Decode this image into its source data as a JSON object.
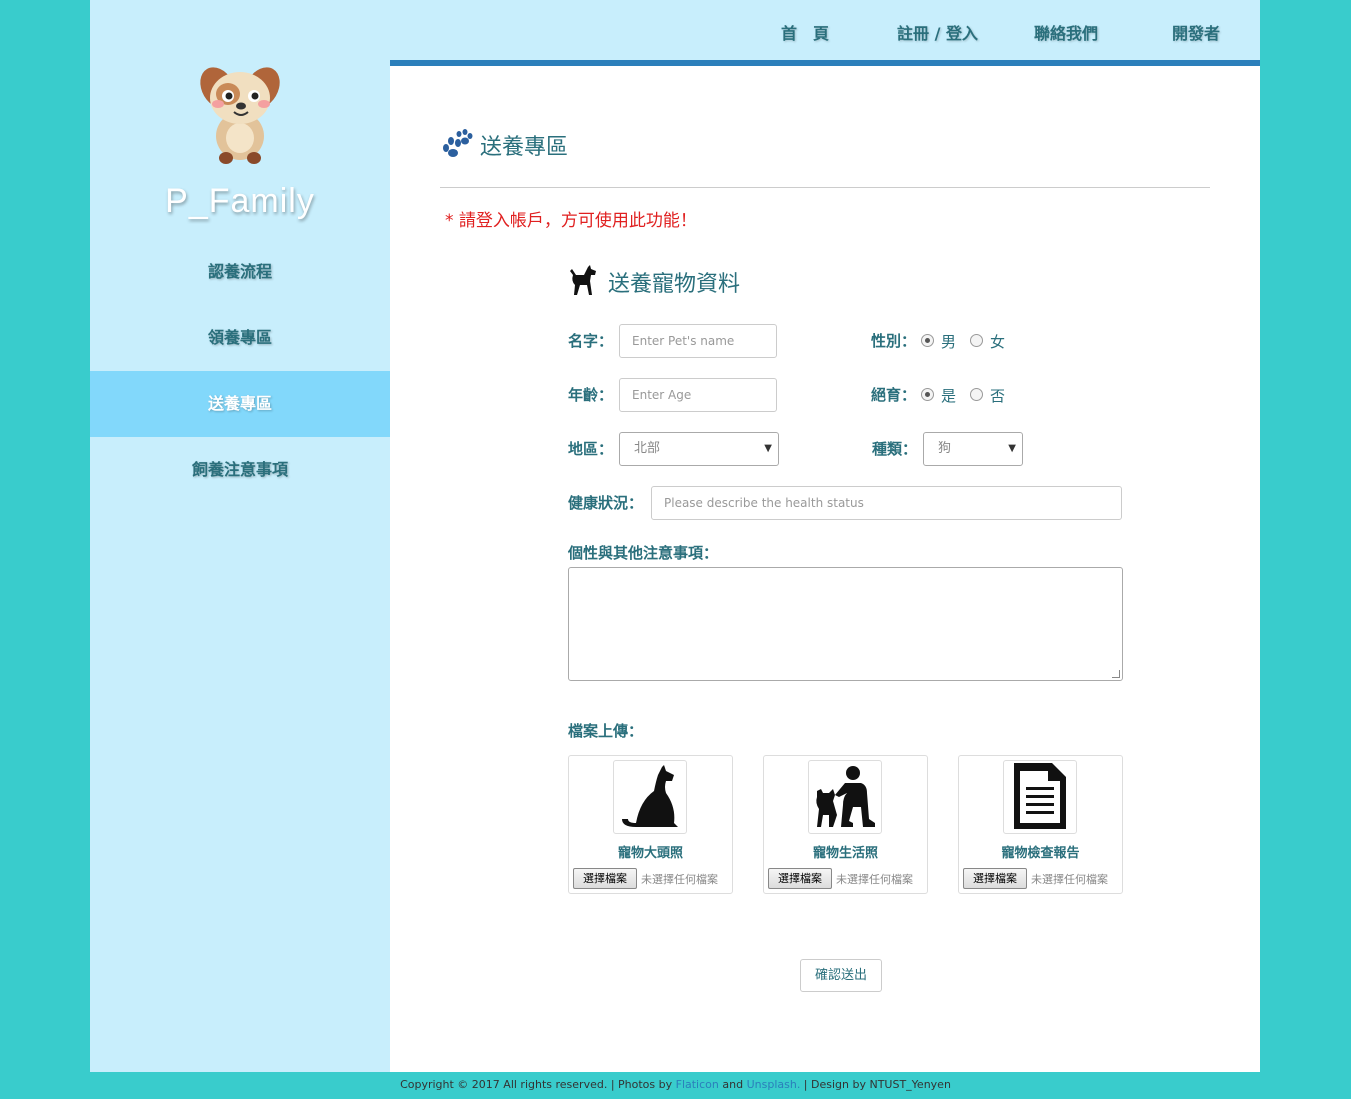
{
  "brand": "P_Family",
  "top_nav": [
    "首　頁",
    "註冊 / 登入",
    "聯絡我們",
    "開發者"
  ],
  "side_nav": [
    "認養流程",
    "領養專區",
    "送養專區",
    "飼養注意事項"
  ],
  "section_title": "送養專區",
  "warning": "* 請登入帳戶，方可使用此功能！",
  "form_title": "送養寵物資料",
  "form": {
    "name_label": "名字：",
    "name_placeholder": "Enter Pet's name",
    "age_label": "年齡：",
    "age_placeholder": "Enter Age",
    "region_label": "地區：",
    "region_value": "北部",
    "gender_label": "性別：",
    "gender_options": [
      "男",
      "女"
    ],
    "neuter_label": "絕育：",
    "neuter_options": [
      "是",
      "否"
    ],
    "type_label": "種類：",
    "type_value": "狗",
    "health_label": "健康狀況：",
    "health_placeholder": "Please describe the health status",
    "personality_label": "個性與其他注意事項：",
    "upload_label": "檔案上傳："
  },
  "uploads": [
    {
      "caption": "寵物大頭照",
      "button": "選擇檔案",
      "status": "未選擇任何檔案",
      "icon": "dog-sitting-icon"
    },
    {
      "caption": "寵物生活照",
      "button": "選擇檔案",
      "status": "未選擇任何檔案",
      "icon": "person-with-dog-icon"
    },
    {
      "caption": "寵物檢查報告",
      "button": "選擇檔案",
      "status": "未選擇任何檔案",
      "icon": "document-icon"
    }
  ],
  "submit_label": "確認送出",
  "footer": {
    "prefix": "Copyright © 2017 All rights reserved. | Photos by ",
    "link1": "Flaticon",
    "and": " and ",
    "link2": "Unsplash.",
    "suffix": " | Design by NTUST_Yenyen"
  },
  "colors": {
    "background": "#39cccc",
    "sidebar": "#c8eefc",
    "active": "#82d8fb",
    "accent": "#2b7fbb",
    "warning": "#e02020",
    "text": "#2a6f7c"
  }
}
